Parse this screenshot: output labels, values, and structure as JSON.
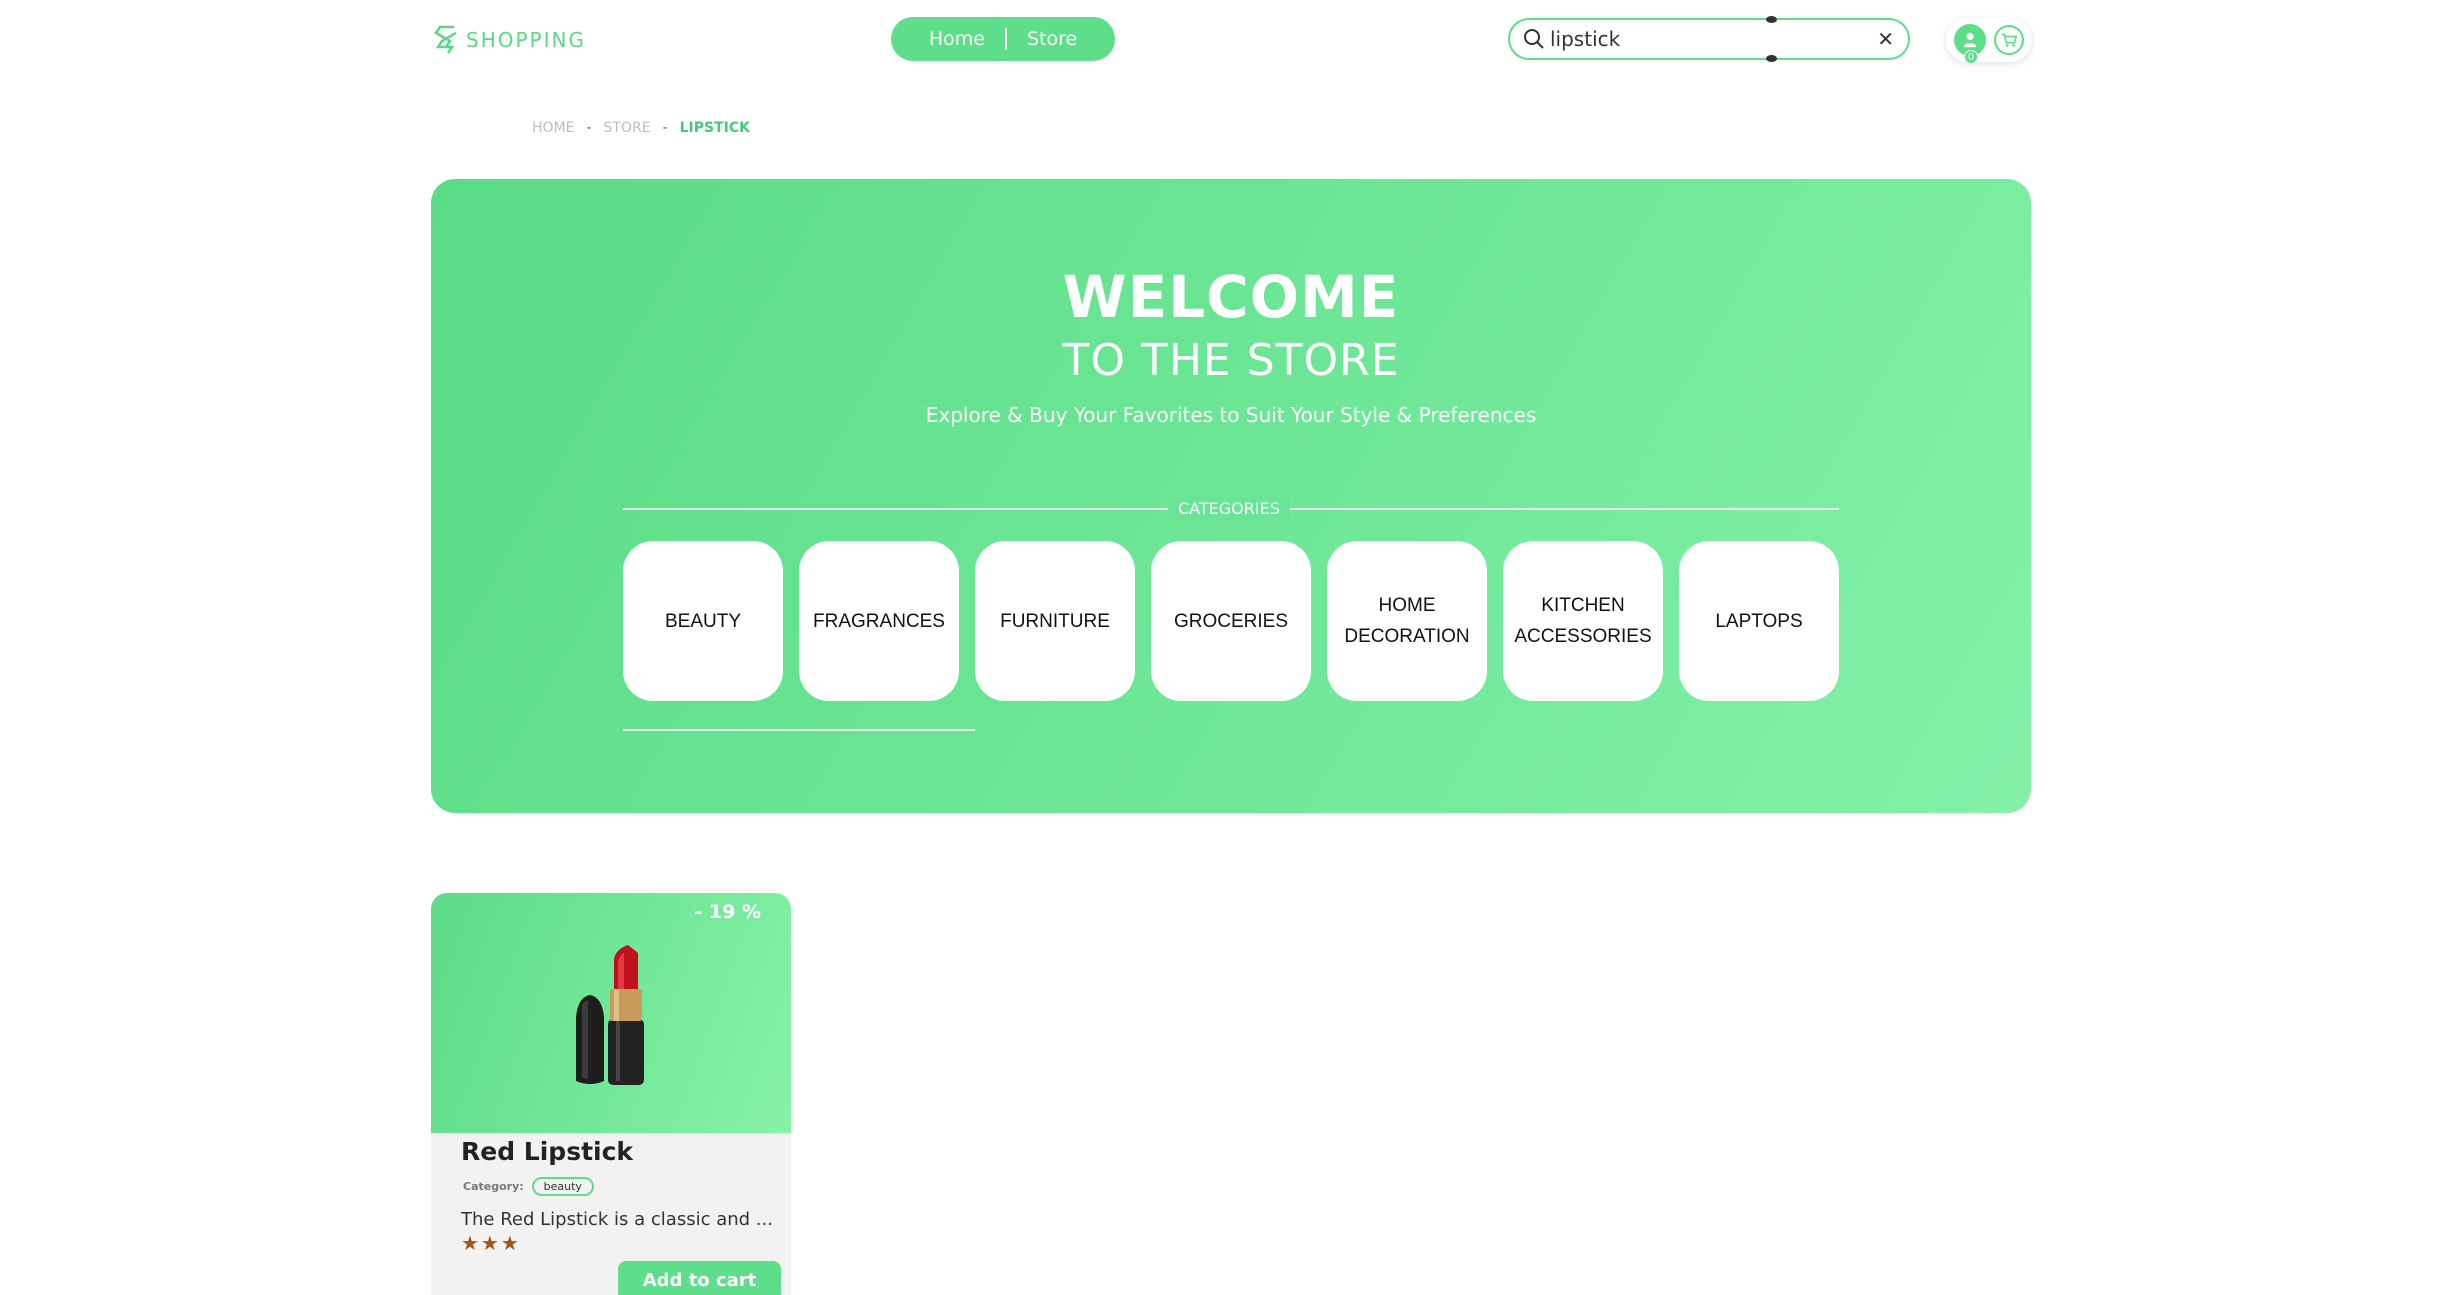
{
  "header": {
    "logo_text": "SHOPPING",
    "nav": [
      "Home",
      "Store"
    ],
    "search": {
      "value": "lipstick",
      "placeholder": ""
    },
    "cart_count": "0"
  },
  "breadcrumb": [
    "HOME",
    "STORE",
    "LIPSTICK"
  ],
  "hero": {
    "title": "WELCOME",
    "subtitle": "TO THE STORE",
    "tagline": "Explore & Buy Your Favorites to Suit Your Style & Preferences",
    "categories_label": "CATEGORIES",
    "categories": [
      "BEAUTY",
      "FRAGRANCES",
      "FURNITURE",
      "GROCERIES",
      "HOME DECORATION",
      "KITCHEN ACCESSORIES",
      "LAPTOPS"
    ],
    "categories_scroll_fraction": 0.29
  },
  "products": [
    {
      "name": "Red Lipstick",
      "discount": "- 19 %",
      "category_label": "Category:",
      "category": "beauty",
      "description": "The Red Lipstick is a classic and ...",
      "stars": "★★★",
      "rating": 3,
      "add_to_cart": "Add to cart"
    }
  ],
  "colors": {
    "accent": "#5edd8a",
    "accent_light": "#84f1a7",
    "breadcrumb_current": "#46c979",
    "star": "#a0571a"
  },
  "icons": [
    "logo-s-icon",
    "search-icon",
    "close-icon",
    "user-icon",
    "cart-icon"
  ]
}
